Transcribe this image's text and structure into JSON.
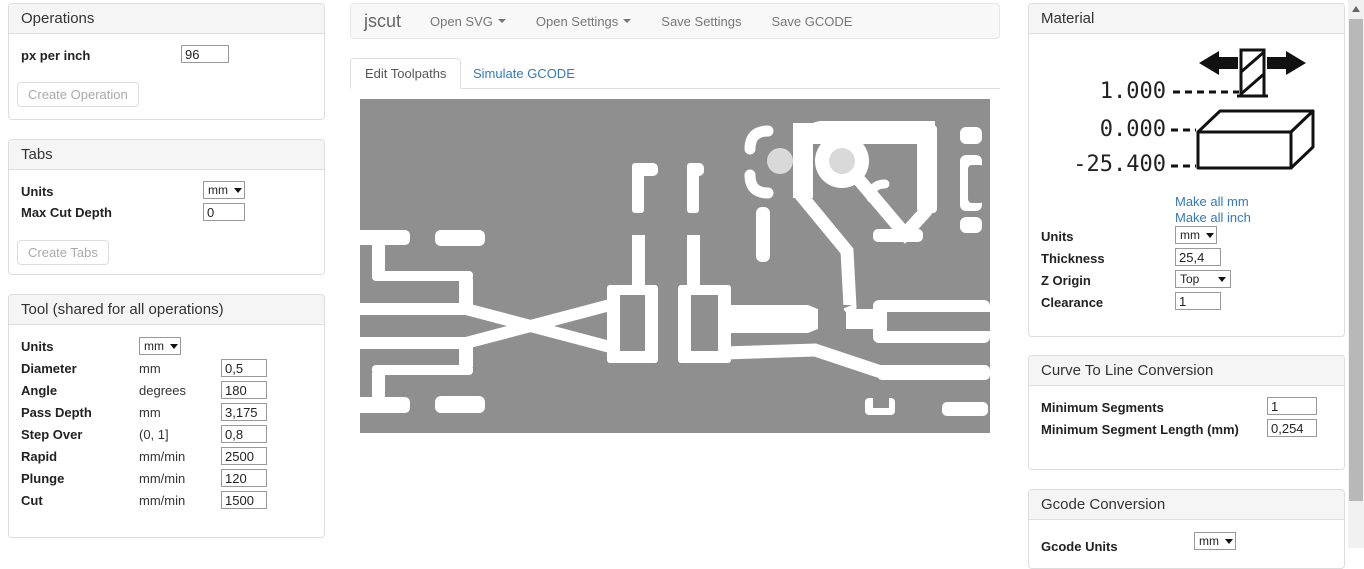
{
  "colors": {
    "accent_link": "#337ab7",
    "pcb_copper_background": "#8f8f8f",
    "pcb_drill_hole": "#d9d9d9",
    "panel_heading_bg": "#f5f5f5",
    "navbar_bg": "#f8f8f8"
  },
  "operations": {
    "title": "Operations",
    "px_per_inch_label": "px per inch",
    "px_per_inch_value": "96",
    "create_operation_label": "Create Operation"
  },
  "tabs_panel": {
    "title": "Tabs",
    "units_label": "Units",
    "units_value": "mm",
    "max_cut_depth_label": "Max Cut Depth",
    "max_cut_depth_value": "0",
    "create_tabs_label": "Create Tabs"
  },
  "tool_panel": {
    "title": "Tool (shared for all operations)",
    "units_label": "Units",
    "units_value": "mm",
    "rows": [
      {
        "label": "Diameter",
        "unit": "mm",
        "value": "0,5"
      },
      {
        "label": "Angle",
        "unit": "degrees",
        "value": "180"
      },
      {
        "label": "Pass Depth",
        "unit": "mm",
        "value": "3,175"
      },
      {
        "label": "Step Over",
        "unit": "(0, 1]",
        "value": "0,8"
      },
      {
        "label": "Rapid",
        "unit": "mm/min",
        "value": "2500"
      },
      {
        "label": "Plunge",
        "unit": "mm/min",
        "value": "120"
      },
      {
        "label": "Cut",
        "unit": "mm/min",
        "value": "1500"
      }
    ]
  },
  "navbar": {
    "brand": "jscut",
    "open_svg": "Open SVG",
    "open_settings": "Open Settings",
    "save_settings": "Save Settings",
    "save_gcode": "Save GCODE"
  },
  "view_tabs": {
    "edit_toolpaths": "Edit Toolpaths",
    "simulate_gcode": "Simulate GCODE"
  },
  "material": {
    "title": "Material",
    "level_top": "1.000",
    "level_surface": "0.000",
    "level_bottom": "-25.400",
    "make_all_mm": "Make all mm",
    "make_all_inch": "Make all inch",
    "units_label": "Units",
    "units_value": "mm",
    "thickness_label": "Thickness",
    "thickness_value": "25,4",
    "z_origin_label": "Z Origin",
    "z_origin_value": "Top",
    "clearance_label": "Clearance",
    "clearance_value": "1"
  },
  "curve": {
    "title": "Curve To Line Conversion",
    "min_segments_label": "Minimum Segments",
    "min_segments_value": "1",
    "min_segment_length_label": "Minimum Segment Length (mm)",
    "min_segment_length_value": "0,254"
  },
  "gcode": {
    "title": "Gcode Conversion",
    "units_label": "Gcode Units",
    "units_value": "mm"
  }
}
